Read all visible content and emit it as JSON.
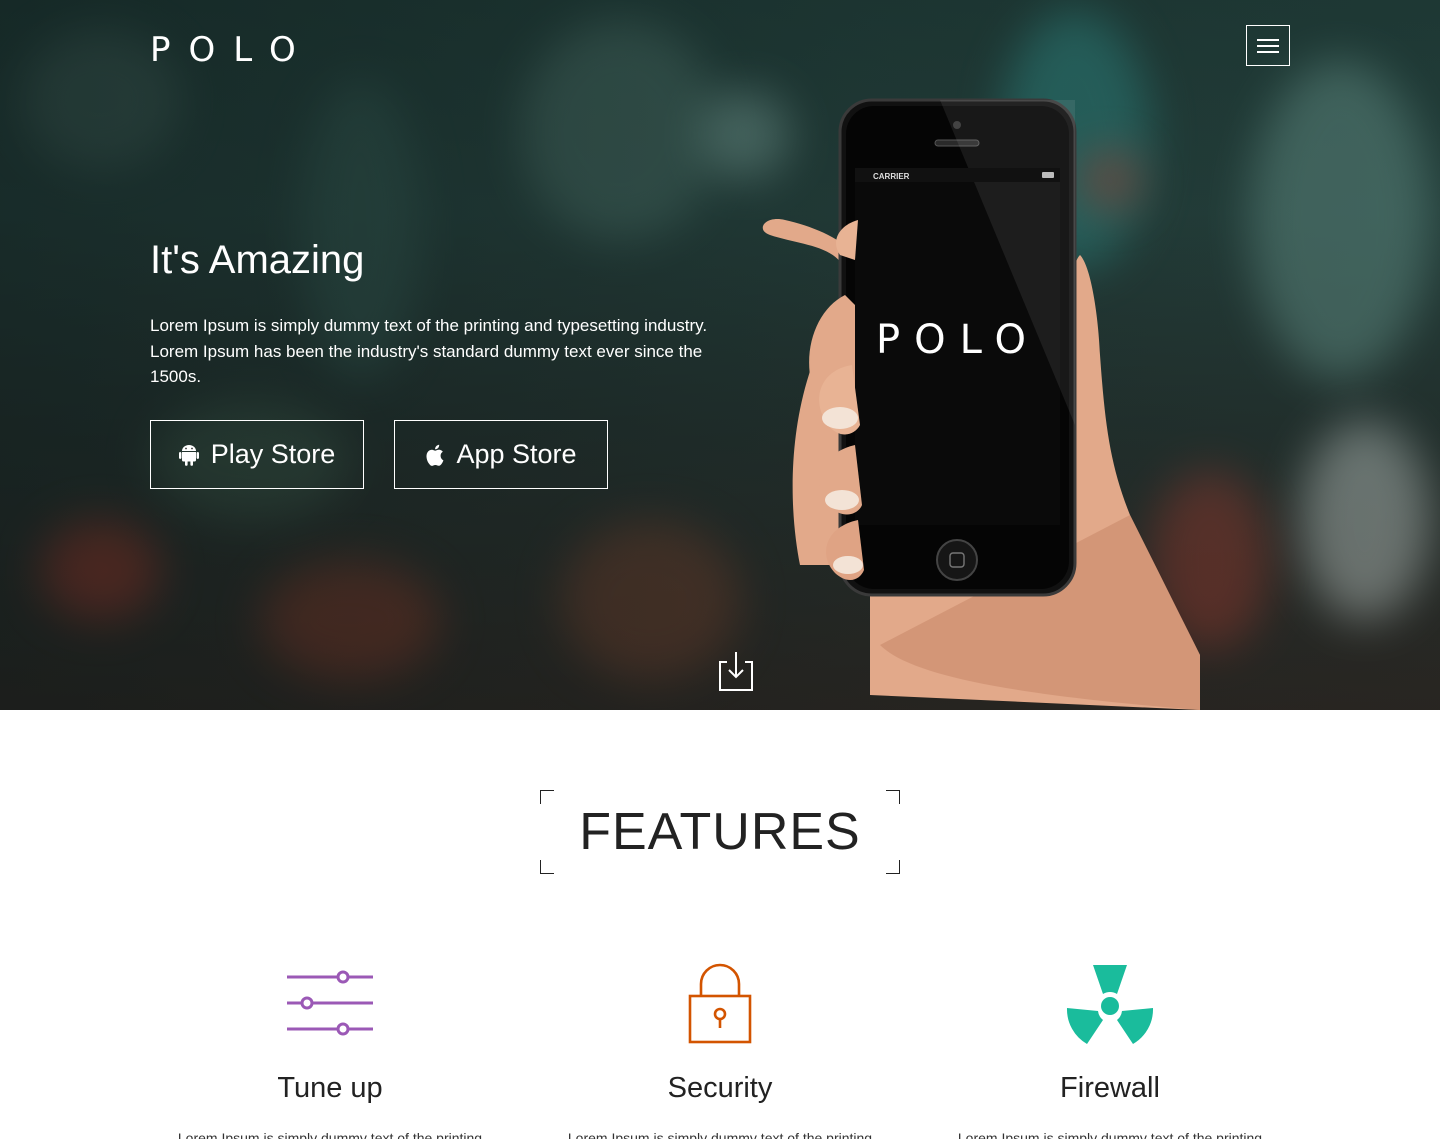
{
  "header": {
    "logo": "POLO",
    "menu_icon": "hamburger-menu-icon"
  },
  "hero": {
    "title": "It's Amazing",
    "text": "Lorem Ipsum is simply dummy text of the printing and typesetting industry. Lorem Ipsum has been the industry's standard dummy text ever since the 1500s.",
    "buttons": [
      {
        "label": "Play Store",
        "icon": "android-icon"
      },
      {
        "label": "App Store",
        "icon": "apple-icon"
      }
    ],
    "phone": {
      "carrier": "CARRIER",
      "screen_logo": "POLO"
    },
    "scroll_icon": "scroll-down-icon"
  },
  "features": {
    "title": "FEATURES",
    "items": [
      {
        "title": "Tune up",
        "text": "Lorem Ipsum is simply dummy text of the printing",
        "icon": "sliders-icon",
        "color": "#9b59b6"
      },
      {
        "title": "Security",
        "text": "Lorem Ipsum is simply dummy text of the printing",
        "icon": "padlock-icon",
        "color": "#d35400"
      },
      {
        "title": "Firewall",
        "text": "Lorem Ipsum is simply dummy text of the printing",
        "icon": "radiation-icon",
        "color": "#1abc9c"
      }
    ]
  },
  "colors": {
    "accent_purple": "#9b59b6",
    "accent_orange": "#d35400",
    "accent_teal": "#1abc9c"
  }
}
